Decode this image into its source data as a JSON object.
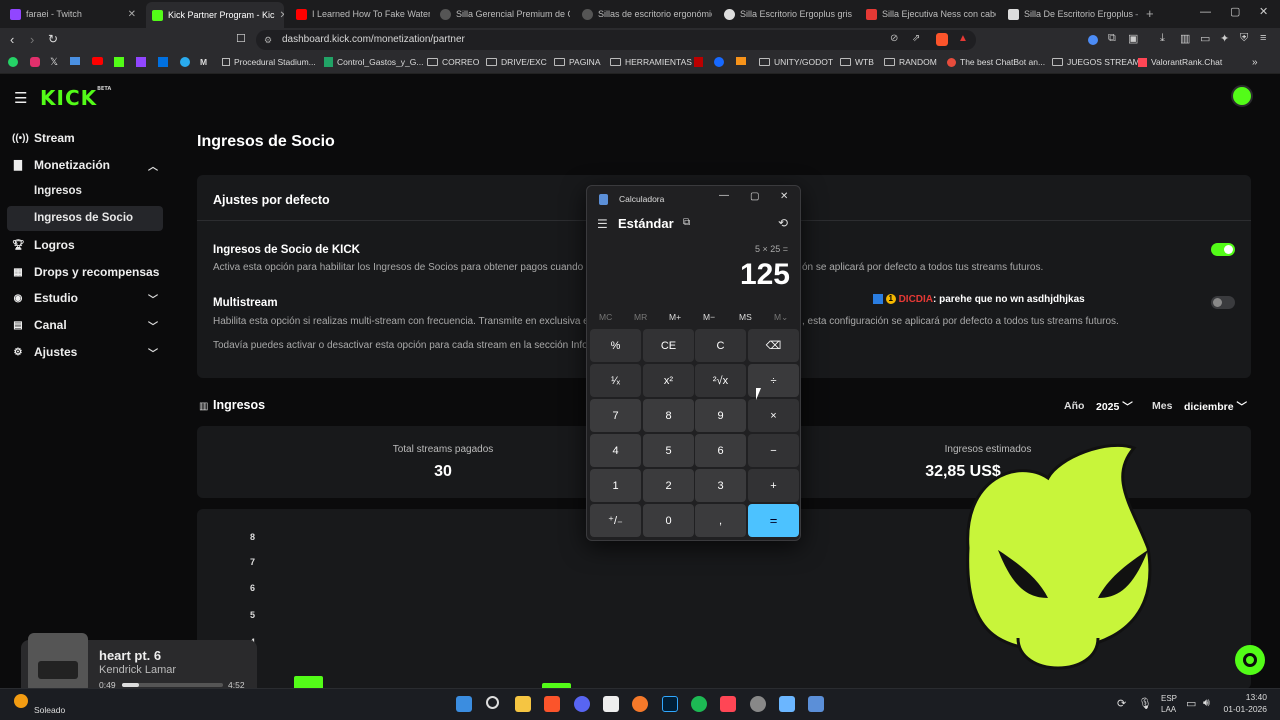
{
  "browser": {
    "tabs": [
      {
        "label": "faraei - Twitch",
        "color": "#9146ff"
      },
      {
        "label": "Kick Partner Program - Kic",
        "color": "#53fc18"
      },
      {
        "label": "I Learned How To Fake Water",
        "color": "#ff0000"
      },
      {
        "label": "Silla Gerencial Premium de Ofi",
        "color": "#777777"
      },
      {
        "label": "Sillas de escritorio ergonómica",
        "color": "#777777"
      },
      {
        "label": "Silla Escritorio Ergoplus gris - T",
        "color": "#dddddd"
      },
      {
        "label": "Silla Ejecutiva Ness con cabece",
        "color": "#e53935"
      },
      {
        "label": "Silla De Escritorio Ergoplus – S",
        "color": "#dddddd"
      }
    ],
    "url": "dashboard.kick.com/monetization/partner",
    "bookmarks": [
      "Procedural Stadium...",
      "Control_Gastos_y_G...",
      "CORREO",
      "DRIVE/EXC",
      "PAGINA",
      "HERRAMIENTAS",
      "UNITY/GODOT",
      "WTB",
      "RANDOM",
      "The best ChatBot an...",
      "JUEGOS STREAM",
      "ValorantRank.Chat"
    ]
  },
  "logo": {
    "text": "KICK",
    "badge": "BETA"
  },
  "sidebar": {
    "items": [
      {
        "label": "Stream"
      },
      {
        "label": "Monetización"
      },
      {
        "label": "Logros"
      },
      {
        "label": "Drops y recompensas"
      },
      {
        "label": "Estudio"
      },
      {
        "label": "Canal"
      },
      {
        "label": "Ajustes"
      }
    ],
    "sub_items": [
      "Ingresos",
      "Ingresos de Socio"
    ]
  },
  "main": {
    "title": "Ingresos de Socio",
    "settings": {
      "header": "Ajustes por defecto",
      "kick_title": "Ingresos de Socio de KICK",
      "kick_desc_left": "Activa esta opción para habilitar los Ingresos de Socios para obtener pagos cuando t",
      "kick_desc_right": "ón se aplicará por defecto a todos tus streams futuros.",
      "multi_title": "Multistream",
      "multi_desc_left": "Habilita esta opción si realizas multi-stream con frecuencia. Transmite en exclusiva e",
      "multi_desc_right": ", esta configuración se aplicará por defecto a todos tus streams futuros.",
      "note": "Todavía puedes activar o desactivar esta opción para cada stream en la sección Info",
      "kick_enabled": true,
      "multi_enabled": false
    },
    "income": {
      "title": "Ingresos",
      "year_label": "Año",
      "year_value": "2025",
      "month_label": "Mes",
      "month_value": "diciembre",
      "stats": [
        {
          "label": "Total streams pagados",
          "value": "30"
        },
        {
          "label": "Ingresos estimados",
          "value": "32,85 US$"
        }
      ],
      "y_ticks": [
        "8",
        "7",
        "6",
        "5",
        "4"
      ]
    }
  },
  "calculator": {
    "window_title": "Calculadora",
    "mode": "Estándar",
    "expression": "5 × 25 =",
    "result": "125",
    "memory": [
      "MC",
      "MR",
      "M+",
      "M−",
      "MS",
      "M⌄"
    ],
    "keys": [
      [
        "%",
        "CE",
        "C",
        "⌫"
      ],
      [
        "¹⁄ₓ",
        "x²",
        "²√x",
        "÷"
      ],
      [
        "7",
        "8",
        "9",
        "×"
      ],
      [
        "4",
        "5",
        "6",
        "−"
      ],
      [
        "1",
        "2",
        "3",
        "+"
      ],
      [
        "⁺/₋",
        "0",
        ",",
        "="
      ]
    ]
  },
  "overlay_chat": {
    "user": "DICDIA",
    "badge": "1",
    "message": ": parehe que no wn asdhjdhjkas"
  },
  "music": {
    "title": "heart pt. 6",
    "artist": "Kendrick Lamar",
    "elapsed": "0:49",
    "duration": "4:52",
    "progress": 0.17
  },
  "taskbar": {
    "weather": "Soleado",
    "lang_top": "ESP",
    "lang_bottom": "LAA",
    "time": "13:40",
    "date": "01-01-2026"
  },
  "colors": {
    "accent": "#53fc18",
    "calc_equals": "#4cc2ff"
  }
}
